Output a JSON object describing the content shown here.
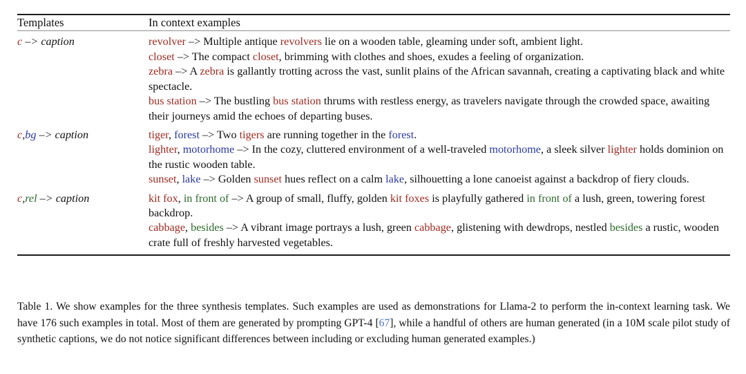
{
  "table": {
    "headers": {
      "templates": "Templates",
      "examples": "In context examples"
    },
    "groups": [
      {
        "template": {
          "parts": [
            {
              "text": "c",
              "role": "concept"
            },
            {
              "text": " –> ",
              "role": "arrow"
            },
            {
              "text": "caption",
              "role": "plain"
            }
          ],
          "plain": "c –> caption"
        },
        "examples": [
          {
            "plain": "revolver –> Multiple antique revolvers lie on a wooden table, gleaming under soft, ambient light.",
            "parts": [
              {
                "text": "revolver",
                "role": "concept"
              },
              {
                "text": " –> ",
                "role": "arrow"
              },
              {
                "text": "Multiple antique ",
                "role": "plain"
              },
              {
                "text": "revolvers",
                "role": "concept"
              },
              {
                "text": " lie on a wooden table, gleaming under soft, ambient light.",
                "role": "plain"
              }
            ]
          },
          {
            "plain": "closet –> The compact closet, brimming with clothes and shoes, exudes a feeling of organization.",
            "parts": [
              {
                "text": "closet",
                "role": "concept"
              },
              {
                "text": " –> ",
                "role": "arrow"
              },
              {
                "text": "The compact ",
                "role": "plain"
              },
              {
                "text": "closet",
                "role": "concept"
              },
              {
                "text": ", brimming with clothes and shoes, exudes a feeling of organization.",
                "role": "plain"
              }
            ]
          },
          {
            "plain": "zebra –> A zebra is gallantly trotting across the vast, sunlit plains of the African savannah, creating a captivating black and white spectacle.",
            "parts": [
              {
                "text": "zebra",
                "role": "concept"
              },
              {
                "text": " –> ",
                "role": "arrow"
              },
              {
                "text": "A ",
                "role": "plain"
              },
              {
                "text": "zebra",
                "role": "concept"
              },
              {
                "text": " is gallantly trotting across the vast, sunlit plains of the African savannah, creating a captivating black and white spectacle.",
                "role": "plain"
              }
            ]
          },
          {
            "plain": "bus station –> The bustling bus station thrums with restless energy, as travelers navigate through the crowded space, awaiting their journeys amid the echoes of departing buses.",
            "parts": [
              {
                "text": "bus station",
                "role": "concept"
              },
              {
                "text": " –> ",
                "role": "arrow"
              },
              {
                "text": "The bustling ",
                "role": "plain"
              },
              {
                "text": "bus station",
                "role": "concept"
              },
              {
                "text": " thrums with restless energy, as travelers navigate through the crowded space, awaiting their journeys amid the echoes of departing buses.",
                "role": "plain"
              }
            ]
          }
        ]
      },
      {
        "template": {
          "parts": [
            {
              "text": "c",
              "role": "concept"
            },
            {
              "text": ",",
              "role": "plain"
            },
            {
              "text": "bg",
              "role": "background"
            },
            {
              "text": " –> ",
              "role": "arrow"
            },
            {
              "text": "caption",
              "role": "plain"
            }
          ],
          "plain": "c,bg –> caption"
        },
        "examples": [
          {
            "plain": "tiger, forest –> Two tigers are running together in the forest.",
            "parts": [
              {
                "text": "tiger",
                "role": "concept"
              },
              {
                "text": ", ",
                "role": "plain"
              },
              {
                "text": "forest",
                "role": "background"
              },
              {
                "text": " –> ",
                "role": "arrow"
              },
              {
                "text": "Two ",
                "role": "plain"
              },
              {
                "text": "tigers",
                "role": "concept"
              },
              {
                "text": " are running together in the ",
                "role": "plain"
              },
              {
                "text": "forest",
                "role": "background"
              },
              {
                "text": ".",
                "role": "plain"
              }
            ]
          },
          {
            "plain": "lighter, motorhome –> In the cozy, cluttered environment of a well-traveled motorhome, a sleek silver lighter holds dominion on the rustic wooden table.",
            "parts": [
              {
                "text": "lighter",
                "role": "concept"
              },
              {
                "text": ", ",
                "role": "plain"
              },
              {
                "text": "motorhome",
                "role": "background"
              },
              {
                "text": " –> ",
                "role": "arrow"
              },
              {
                "text": "In the cozy, cluttered environment of a well-traveled ",
                "role": "plain"
              },
              {
                "text": "motorhome",
                "role": "background"
              },
              {
                "text": ", a sleek silver ",
                "role": "plain"
              },
              {
                "text": "lighter",
                "role": "concept"
              },
              {
                "text": " holds dominion on the rustic wooden table.",
                "role": "plain"
              }
            ]
          },
          {
            "plain": "sunset, lake –> Golden sunset hues reflect on a calm lake, silhouetting a lone canoeist against a backdrop of fiery clouds.",
            "parts": [
              {
                "text": "sunset",
                "role": "concept"
              },
              {
                "text": ", ",
                "role": "plain"
              },
              {
                "text": "lake",
                "role": "background"
              },
              {
                "text": " –> ",
                "role": "arrow"
              },
              {
                "text": "Golden ",
                "role": "plain"
              },
              {
                "text": "sunset",
                "role": "concept"
              },
              {
                "text": " hues reflect on a calm ",
                "role": "plain"
              },
              {
                "text": "lake",
                "role": "background"
              },
              {
                "text": ", silhouetting a lone canoeist against a backdrop of fiery clouds.",
                "role": "plain"
              }
            ]
          }
        ]
      },
      {
        "template": {
          "parts": [
            {
              "text": "c",
              "role": "concept"
            },
            {
              "text": ",",
              "role": "plain"
            },
            {
              "text": "rel",
              "role": "relation"
            },
            {
              "text": " –> ",
              "role": "arrow"
            },
            {
              "text": "caption",
              "role": "plain"
            }
          ],
          "plain": "c,rel –> caption"
        },
        "examples": [
          {
            "plain": "kit fox, in front of –> A group of small, fluffy, golden kit foxes is playfully gathered in front of a lush, green, towering forest backdrop.",
            "parts": [
              {
                "text": "kit fox",
                "role": "concept"
              },
              {
                "text": ", ",
                "role": "plain"
              },
              {
                "text": "in front of",
                "role": "relation"
              },
              {
                "text": " –> ",
                "role": "arrow"
              },
              {
                "text": "A group of small, fluffy, golden ",
                "role": "plain"
              },
              {
                "text": "kit foxes",
                "role": "concept"
              },
              {
                "text": " is playfully gathered ",
                "role": "plain"
              },
              {
                "text": "in front of",
                "role": "relation"
              },
              {
                "text": " a lush, green, towering forest backdrop.",
                "role": "plain"
              }
            ]
          },
          {
            "plain": "cabbage, besides –> A vibrant image portrays a lush, green cabbage, glistening with dewdrops, nestled besides a rustic, wooden crate full of freshly harvested vegetables.",
            "parts": [
              {
                "text": "cabbage",
                "role": "concept"
              },
              {
                "text": ", ",
                "role": "plain"
              },
              {
                "text": "besides",
                "role": "relation"
              },
              {
                "text": " –> ",
                "role": "arrow"
              },
              {
                "text": "A vibrant image portrays a lush, green ",
                "role": "plain"
              },
              {
                "text": "cabbage",
                "role": "concept"
              },
              {
                "text": ", glistening with dewdrops, nestled ",
                "role": "plain"
              },
              {
                "text": "besides",
                "role": "relation"
              },
              {
                "text": " a rustic, wooden crate full of freshly harvested vegetables.",
                "role": "plain"
              }
            ]
          }
        ]
      }
    ]
  },
  "caption": {
    "label": "Table 1.",
    "segment_1": " We show examples for the three synthesis templates. Such examples are used as demonstrations for Llama-2 to perform the in-context learning task. We have 176 such examples in total. Most of them are generated by prompting GPT-4 [",
    "citation": "67",
    "segment_2": "], while a handful of others are human generated (in a 10M scale pilot study of synthetic captions, we do not notice significant differences between including or excluding human generated examples.)",
    "full_text": "Table 1. We show examples for the three synthesis templates. Such examples are used as demonstrations for Llama-2 to perform the in-context learning task. We have 176 such examples in total. Most of them are generated by prompting GPT-4 [67], while a handful of others are human generated (in a 10M scale pilot study of synthetic captions, we do not notice significant differences between including or excluding human generated examples.)"
  },
  "colors": {
    "concept": "#9e2a20",
    "background": "#2a3a9e",
    "relation": "#2d6a2d",
    "citation": "#4a72c8",
    "rule_dark": "#1b1b1b",
    "rule_light": "#8e8e8e",
    "text": "#111111",
    "page_background": "#ffffff"
  }
}
